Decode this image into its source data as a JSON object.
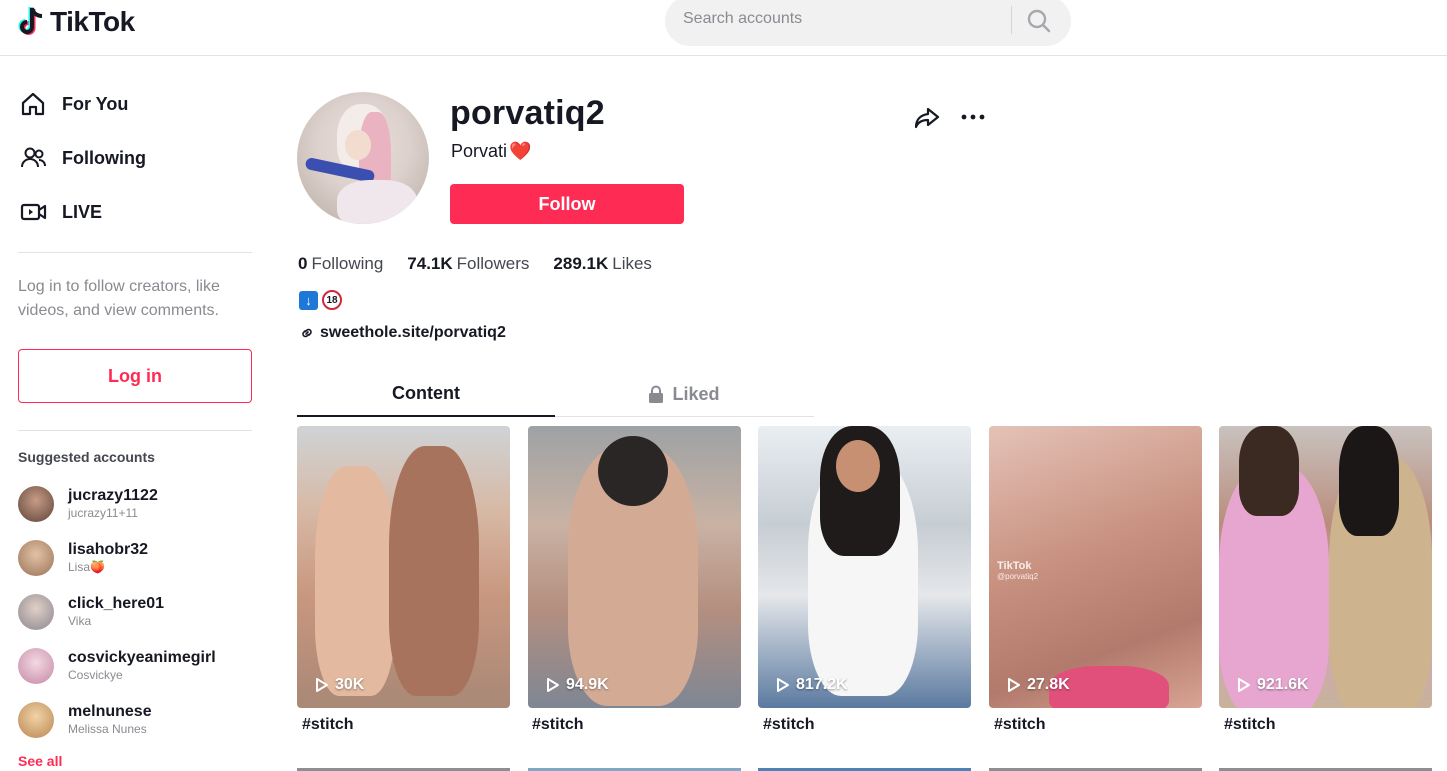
{
  "header": {
    "logo_text": "TikTok",
    "search_placeholder": "Search accounts"
  },
  "sidebar": {
    "nav": [
      {
        "label": "For You",
        "icon": "home-icon"
      },
      {
        "label": "Following",
        "icon": "users-icon"
      },
      {
        "label": "LIVE",
        "icon": "live-icon"
      }
    ],
    "login_hint": "Log in to follow creators, like videos, and view comments.",
    "login_button": "Log in",
    "suggested_title": "Suggested accounts",
    "suggested": [
      {
        "name": "jucrazy1122",
        "sub": "jucrazy11+11",
        "color": "#7a5a4e"
      },
      {
        "name": "lisahobr32",
        "sub": "Lisa🍑",
        "color": "#b8906f"
      },
      {
        "name": "click_here01",
        "sub": "Vika",
        "color": "#a7a2a8"
      },
      {
        "name": "cosvickyeanimegirl",
        "sub": "Cosvickye",
        "color": "#d7a2b9"
      },
      {
        "name": "melnunese",
        "sub": "Melissa Nunes",
        "color": "#d8b079"
      }
    ],
    "see_all": "See all"
  },
  "profile": {
    "username": "porvatiq2",
    "nickname": "Porvati",
    "nickname_emoji": "❤️",
    "follow_button": "Follow",
    "stats": {
      "following_count": "0",
      "following_label": "Following",
      "followers_count": "74.1K",
      "followers_label": "Followers",
      "likes_count": "289.1K",
      "likes_label": "Likes"
    },
    "bio_arrow": "↓",
    "bio_18": "18",
    "link": "sweethole.site/porvatiq2"
  },
  "tabs": {
    "content": "Content",
    "liked": "Liked"
  },
  "videos": [
    {
      "views": "30K",
      "caption": "#stitch"
    },
    {
      "views": "94.9K",
      "caption": "#stitch"
    },
    {
      "views": "817.2K",
      "caption": "#stitch"
    },
    {
      "views": "27.8K",
      "caption": "#stitch",
      "watermark": "TikTok",
      "watermark_sub": "@porvatiq2"
    },
    {
      "views": "921.6K",
      "caption": "#stitch"
    }
  ],
  "colors": {
    "accent": "#fe2c55",
    "text": "#161823",
    "muted": "#8a8b91"
  }
}
